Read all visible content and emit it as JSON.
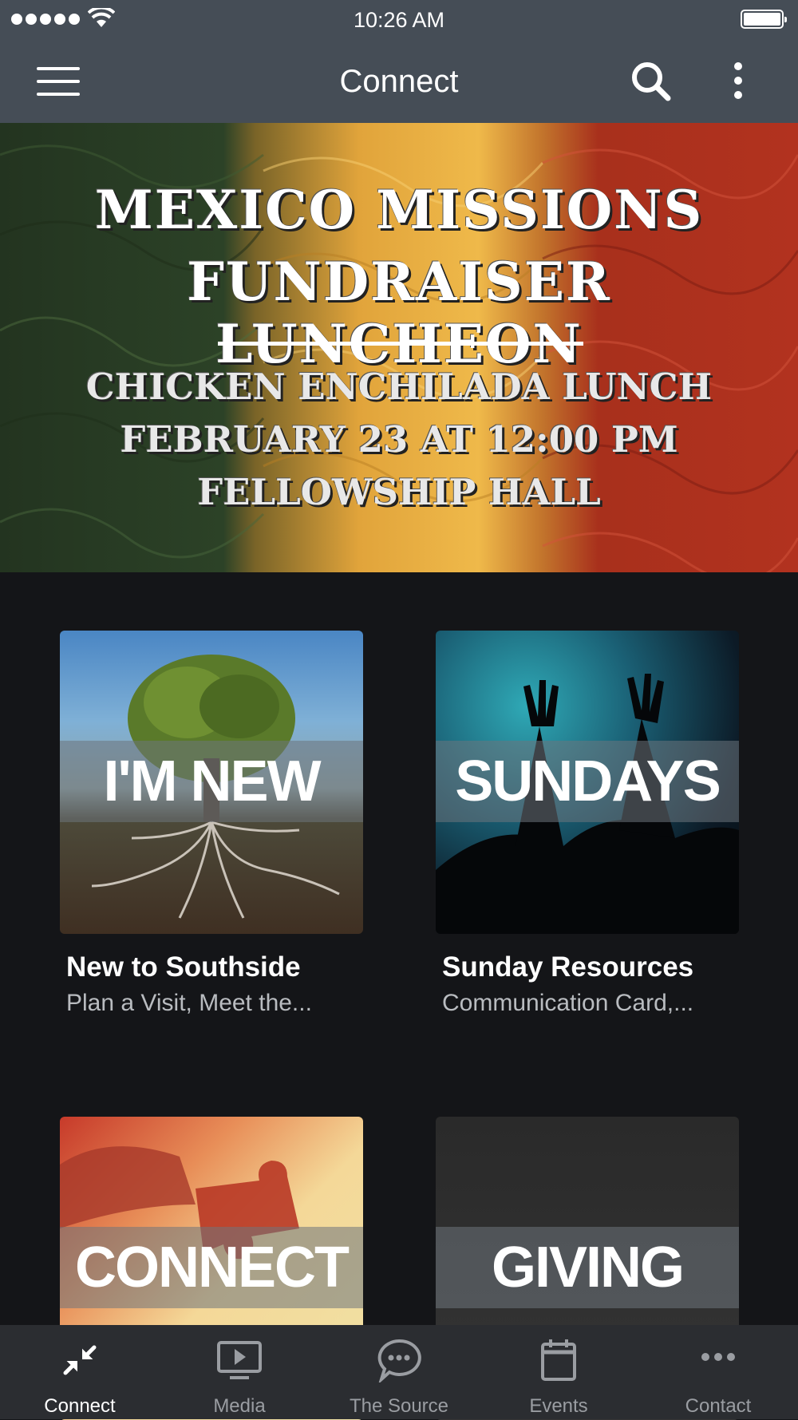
{
  "status_bar": {
    "time": "10:26 AM"
  },
  "header": {
    "title": "Connect"
  },
  "banner": {
    "title_line1": "MEXICO MISSIONS",
    "title_line2": "FUNDRAISER LUNCHEON",
    "line1": "CHICKEN ENCHILADA LUNCH",
    "line2": "FEBRUARY 23 AT 12:00 PM",
    "line3": "FELLOWSHIP HALL"
  },
  "tiles": [
    {
      "image_text": "I'M NEW",
      "title": "New to Southside",
      "subtitle": "Plan a Visit, Meet the..."
    },
    {
      "image_text": "SUNDAYS",
      "title": "Sunday Resources",
      "subtitle": "Communication Card,..."
    },
    {
      "image_text": "CONNECT",
      "title": "",
      "subtitle": ""
    },
    {
      "image_text": "GIVING",
      "title": "",
      "subtitle": ""
    }
  ],
  "tab_bar": {
    "items": [
      {
        "label": "Connect",
        "icon": "arrows-in-icon",
        "active": true
      },
      {
        "label": "Media",
        "icon": "play-screen-icon",
        "active": false
      },
      {
        "label": "The Source",
        "icon": "chat-bubble-icon",
        "active": false
      },
      {
        "label": "Events",
        "icon": "calendar-icon",
        "active": false
      },
      {
        "label": "Contact",
        "icon": "more-dots-icon",
        "active": false
      }
    ]
  }
}
